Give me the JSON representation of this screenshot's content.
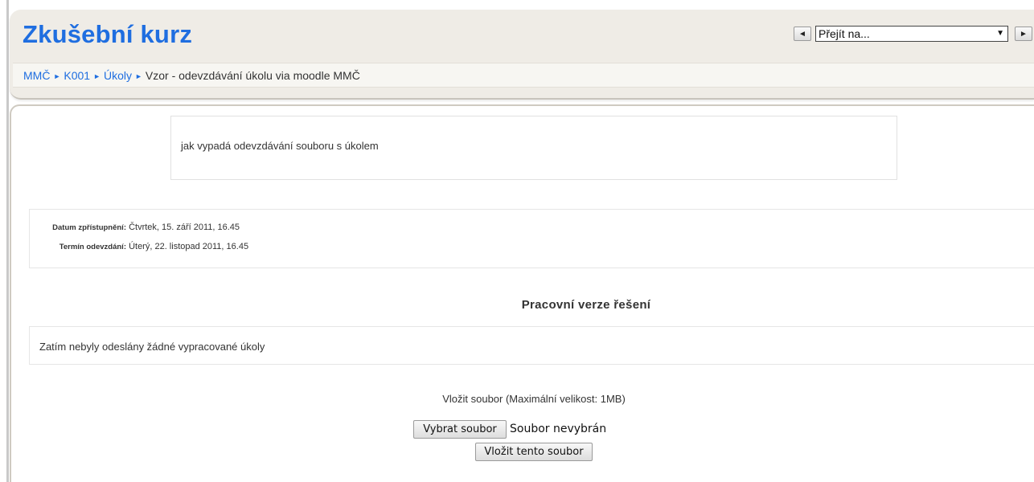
{
  "header": {
    "title": "Zkušební kurz",
    "jump": {
      "prev_icon": "triangle-left",
      "next_icon": "triangle-right",
      "selected": "Přejít na..."
    }
  },
  "breadcrumb": {
    "items": [
      "MMČ",
      "K001",
      "Úkoly"
    ],
    "current": "Vzor - odevzdávání úkolu via moodle MMČ"
  },
  "intro": {
    "text": "jak vypadá odevzdávání souboru s úkolem"
  },
  "dates": {
    "available_label": "Datum zpřístupnění:",
    "available_value": "Čtvrtek, 15. září 2011, 16.45",
    "due_label": "Termín odevzdání:",
    "due_value": "Úterý, 22. listopad 2011, 16.45"
  },
  "draft": {
    "heading": "Pracovní verze řešení",
    "empty_text": "Zatím nebyly odeslány žádné vypracované úkoly"
  },
  "upload": {
    "label": "Vložit soubor (Maximální velikost: 1MB)",
    "choose_button": "Vybrat soubor",
    "file_status": "Soubor nevybrán",
    "submit_button": "Vložit tento soubor"
  },
  "colors": {
    "accent": "#1f6ee0",
    "header_bg": "#efece6"
  }
}
